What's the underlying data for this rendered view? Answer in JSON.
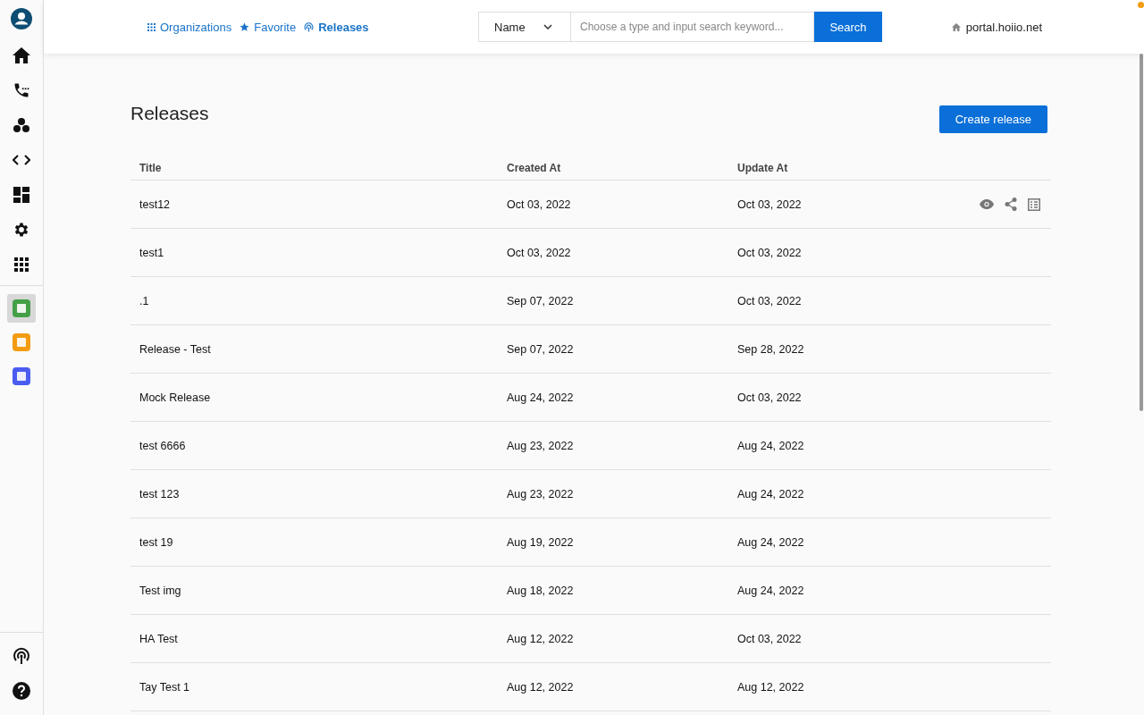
{
  "sidebar": {
    "top_items": [
      {
        "kind": "avatar"
      },
      {
        "kind": "home"
      },
      {
        "kind": "phone"
      },
      {
        "kind": "group"
      },
      {
        "kind": "code"
      },
      {
        "kind": "dashboard"
      },
      {
        "kind": "settings"
      },
      {
        "kind": "apps"
      }
    ],
    "apps": [
      {
        "color": "#43a047",
        "selected": true
      },
      {
        "color": "#f39c12",
        "selected": false
      },
      {
        "color": "#4a5df0",
        "selected": false
      }
    ],
    "bottom_items": [
      {
        "kind": "broadcast"
      },
      {
        "kind": "help"
      }
    ]
  },
  "breadcrumbs": [
    {
      "label": "Organizations",
      "kind": "grid",
      "selected": false
    },
    {
      "label": "Favorite",
      "kind": "star",
      "selected": false
    },
    {
      "label": "Releases",
      "kind": "broadcast",
      "selected": true
    }
  ],
  "search": {
    "field": "Name",
    "placeholder": "Choose a type and input search keyword...",
    "button": "Search"
  },
  "host": "portal.hoiio.net",
  "page_title": "Releases",
  "create_button": "Create release",
  "table": {
    "columns": [
      "Title",
      "Created At",
      "Update At"
    ],
    "rows": [
      {
        "cells": [
          "test12",
          "Oct 03, 2022",
          "Oct 03, 2022"
        ],
        "hovered": true
      },
      {
        "cells": [
          "test1",
          "Oct 03, 2022",
          "Oct 03, 2022"
        ],
        "hovered": false
      },
      {
        "cells": [
          ".1",
          "Sep 07, 2022",
          "Oct 03, 2022"
        ],
        "hovered": false
      },
      {
        "cells": [
          "Release - Test",
          "Sep 07, 2022",
          "Sep 28, 2022"
        ],
        "hovered": false
      },
      {
        "cells": [
          "Mock Release",
          "Aug 24, 2022",
          "Oct 03, 2022"
        ],
        "hovered": false
      },
      {
        "cells": [
          "test 6666",
          "Aug 23, 2022",
          "Aug 24, 2022"
        ],
        "hovered": false
      },
      {
        "cells": [
          "test 123",
          "Aug 23, 2022",
          "Aug 24, 2022"
        ],
        "hovered": false
      },
      {
        "cells": [
          "test 19",
          "Aug 19, 2022",
          "Aug 24, 2022"
        ],
        "hovered": false
      },
      {
        "cells": [
          "Test img",
          "Aug 18, 2022",
          "Aug 24, 2022"
        ],
        "hovered": false
      },
      {
        "cells": [
          "HA Test",
          "Aug 12, 2022",
          "Oct 03, 2022"
        ],
        "hovered": false
      },
      {
        "cells": [
          "Tay Test 1",
          "Aug 12, 2022",
          "Aug 12, 2022"
        ],
        "hovered": false
      }
    ]
  }
}
